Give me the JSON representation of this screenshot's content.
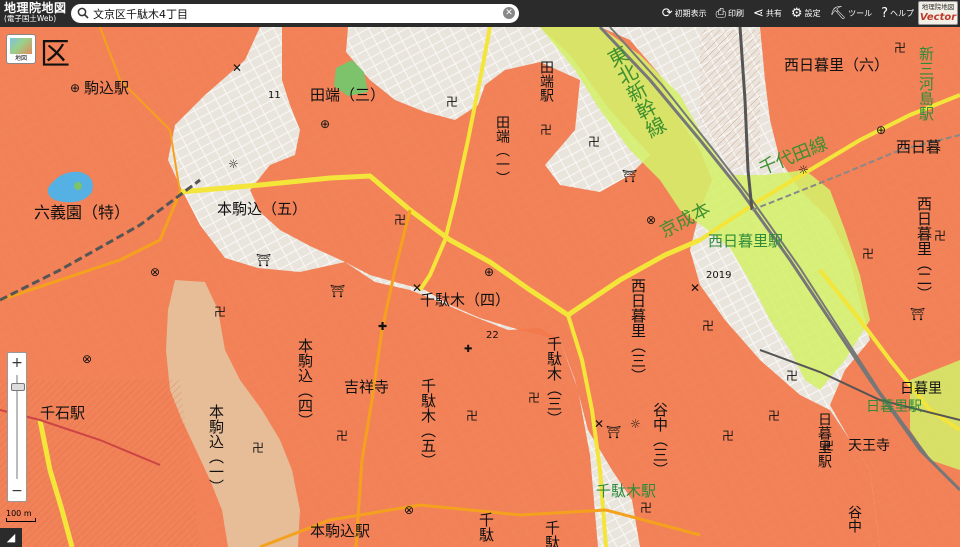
{
  "app": {
    "title": "地理院地図",
    "subtitle": "(電子国土Web)",
    "vector_badge_top": "地理院地図",
    "vector_badge_bottom": "Vector"
  },
  "search": {
    "value": "文京区千駄木4丁目",
    "icon": "search-icon",
    "clear_icon": "close-icon"
  },
  "toolbar": {
    "items": [
      {
        "label": "初期表示",
        "icon": "reset-icon"
      },
      {
        "label": "印刷",
        "icon": "printer-icon"
      },
      {
        "label": "共有",
        "icon": "share-icon"
      },
      {
        "label": "設定",
        "icon": "gear-icon"
      },
      {
        "label": "ツール",
        "icon": "tool-icon"
      },
      {
        "label": "ヘルプ",
        "icon": "help-icon"
      }
    ]
  },
  "controls": {
    "layer_button_label": "地図",
    "zoom_in": "+",
    "zoom_out": "−",
    "scale_label": "100 m",
    "collapse": "◢"
  },
  "map": {
    "colors": {
      "base": "#e9e4dc",
      "hazard_orange": "#f27a4c",
      "hazard_beige": "#e6c3a0",
      "shinkansen_green": "#d4f06a",
      "park_green": "#7cc36c",
      "pond_blue": "#55b0e4",
      "road_yellow": "#f4e53a",
      "road_orange": "#f4a21e"
    },
    "labels": {
      "bunkyo_ku": "区",
      "komagome_st": "駒込駅",
      "rikugien": "六義園（特）",
      "hon_komagome_5": "本駒込（五）",
      "tabata_3": "田端（三）",
      "tabata_1": "田端（一）",
      "tabata_st": "田端駅",
      "tohoku_shinkansen": "東北新幹線",
      "nishinippori_6": "西日暮里（六）",
      "shin_mikawashima_st": "新三河島駅",
      "nishinippori_a": "西日暮",
      "nishinippori_2": "西日暮里（二）",
      "chiyoda_line": "千代田線",
      "keisei_line": "京成本",
      "nishinippori_st": "西日暮里駅",
      "sendagi_4": "千駄木（四）",
      "nishinippori_3": "西日暮里（三）",
      "hon_komagome_4": "本駒込（四）",
      "kichijoji": "吉祥寺",
      "sendagi_5": "千駄木（五）",
      "sendagi_3": "千駄木（三）",
      "hon_komagome_1": "本駒込（一）",
      "sengoku_st": "千石駅",
      "yanaka_3": "谷中（三）",
      "sendagi_st": "千駄木駅",
      "hon_komagome_st": "本駒込駅",
      "nippori_st": "日暮里駅",
      "nippori_st2": "日暮里駅",
      "nippori_a": "日暮里",
      "tennoji": "天王寺",
      "yanaka": "谷中",
      "sendagi_b": "千駄",
      "sendagi_c": "千駄",
      "elev_11": "11",
      "elev_22": "22",
      "elev_2019": "2019"
    }
  }
}
